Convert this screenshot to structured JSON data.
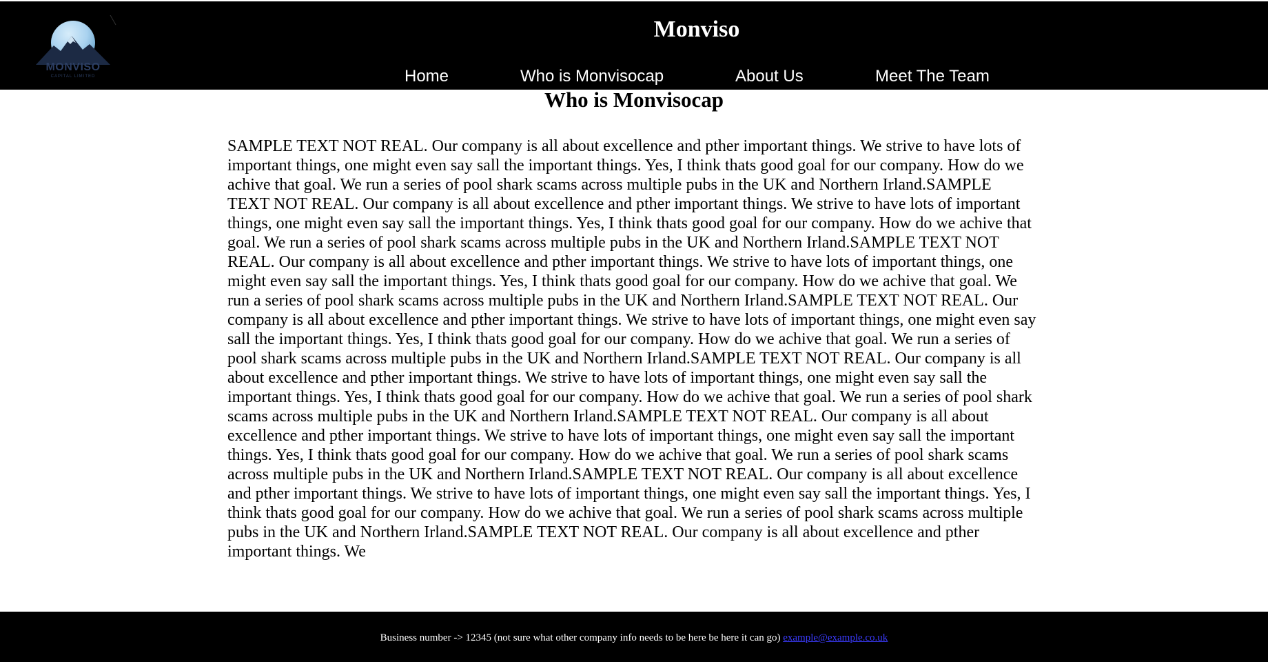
{
  "header": {
    "site_title": "Monviso",
    "logo": {
      "icon": "mountain-logo-icon",
      "wordmark": "MONVISO",
      "tagline": "CAPITAL LIMITED"
    },
    "nav": {
      "home": "Home",
      "who": "Who is Monvisocap",
      "about": "About Us",
      "team": "Meet The Team"
    }
  },
  "main": {
    "heading": "Who is Monvisocap",
    "body": "SAMPLE TEXT NOT REAL. Our company is all about excellence and pther important things. We strive to have lots of important things, one might even say sall the important things. Yes, I think thats good goal for our company. How do we achive that goal. We run a series of pool shark scams across multiple pubs in the UK and Northern Irland.SAMPLE TEXT NOT REAL. Our company is all about excellence and pther important things. We strive to have lots of important things, one might even say sall the important things. Yes, I think thats good goal for our company. How do we achive that goal. We run a series of pool shark scams across multiple pubs in the UK and Northern Irland.SAMPLE TEXT NOT REAL. Our company is all about excellence and pther important things. We strive to have lots of important things, one might even say sall the important things. Yes, I think thats good goal for our company. How do we achive that goal. We run a series of pool shark scams across multiple pubs in the UK and Northern Irland.SAMPLE TEXT NOT REAL. Our company is all about excellence and pther important things. We strive to have lots of important things, one might even say sall the important things. Yes, I think thats good goal for our company. How do we achive that goal. We run a series of pool shark scams across multiple pubs in the UK and Northern Irland.SAMPLE TEXT NOT REAL. Our company is all about excellence and pther important things. We strive to have lots of important things, one might even say sall the important things. Yes, I think thats good goal for our company. How do we achive that goal. We run a series of pool shark scams across multiple pubs in the UK and Northern Irland.SAMPLE TEXT NOT REAL. Our company is all about excellence and pther important things. We strive to have lots of important things, one might even say sall the important things. Yes, I think thats good goal for our company. How do we achive that goal. We run a series of pool shark scams across multiple pubs in the UK and Northern Irland.SAMPLE TEXT NOT REAL. Our company is all about excellence and pther important things. We strive to have lots of important things, one might even say sall the important things. Yes, I think thats good goal for our company. How do we achive that goal. We run a series of pool shark scams across multiple pubs in the UK and Northern Irland.SAMPLE TEXT NOT REAL. Our company is all about excellence and pther important things. We"
  },
  "footer": {
    "text": "Business number -> 12345 (not sure what other company info needs to be here be here it can go)",
    "email": "example@example.co.uk"
  },
  "colors": {
    "header_bg": "#000000",
    "footer_bg": "#000000",
    "link": "#3b3bff",
    "logo_moon": "#a9d2ef",
    "logo_mountain": "#1c2a44"
  }
}
